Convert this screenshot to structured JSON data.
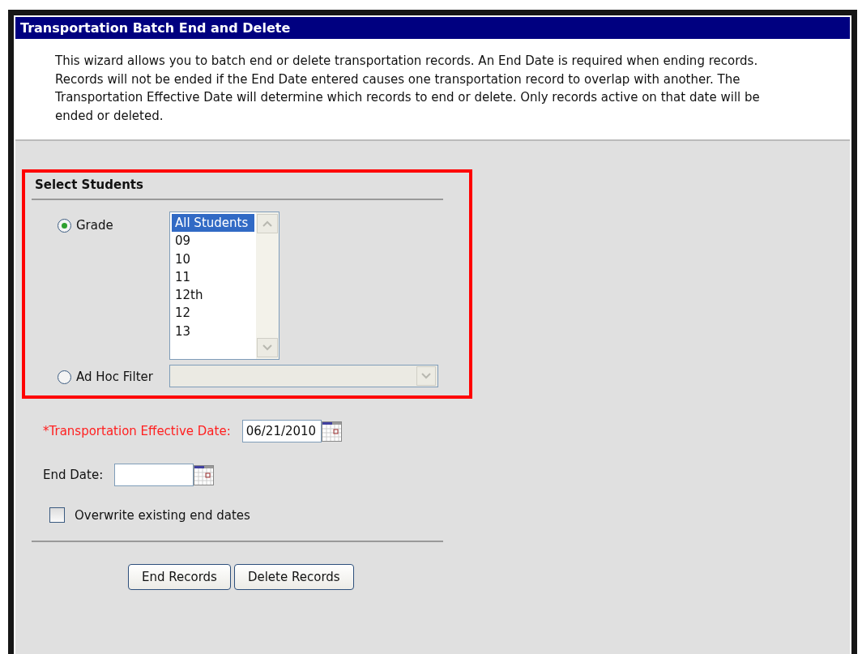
{
  "window": {
    "title": "Transportation Batch End and Delete"
  },
  "description": "This wizard allows you to batch end or delete transportation records. An End Date is required when ending records. Records will not be ended if the End Date entered causes one transportation record to overlap with another. The Transportation Effective Date will determine which records to end or delete. Only records active on that date will be ended or deleted.",
  "select_students": {
    "heading": "Select Students",
    "highlighted": true,
    "options": [
      {
        "label": "Grade",
        "selected": true
      },
      {
        "label": "Ad Hoc Filter",
        "selected": false
      }
    ],
    "grade_list": [
      {
        "label": "All Students",
        "selected": true
      },
      {
        "label": "09",
        "selected": false
      },
      {
        "label": "10",
        "selected": false
      },
      {
        "label": "11",
        "selected": false
      },
      {
        "label": "12th",
        "selected": false
      },
      {
        "label": "12",
        "selected": false
      },
      {
        "label": "13",
        "selected": false
      }
    ],
    "ad_hoc_filter": {
      "disabled": true
    }
  },
  "fields": [
    {
      "label": "*Transportation Effective Date:",
      "required": true,
      "value": "06/21/2010"
    },
    {
      "label": "End Date:",
      "required": false
    }
  ],
  "overwrite": {
    "label": "Overwrite existing end dates",
    "checked": false
  },
  "buttons": [
    "End Records",
    "Delete Records"
  ]
}
